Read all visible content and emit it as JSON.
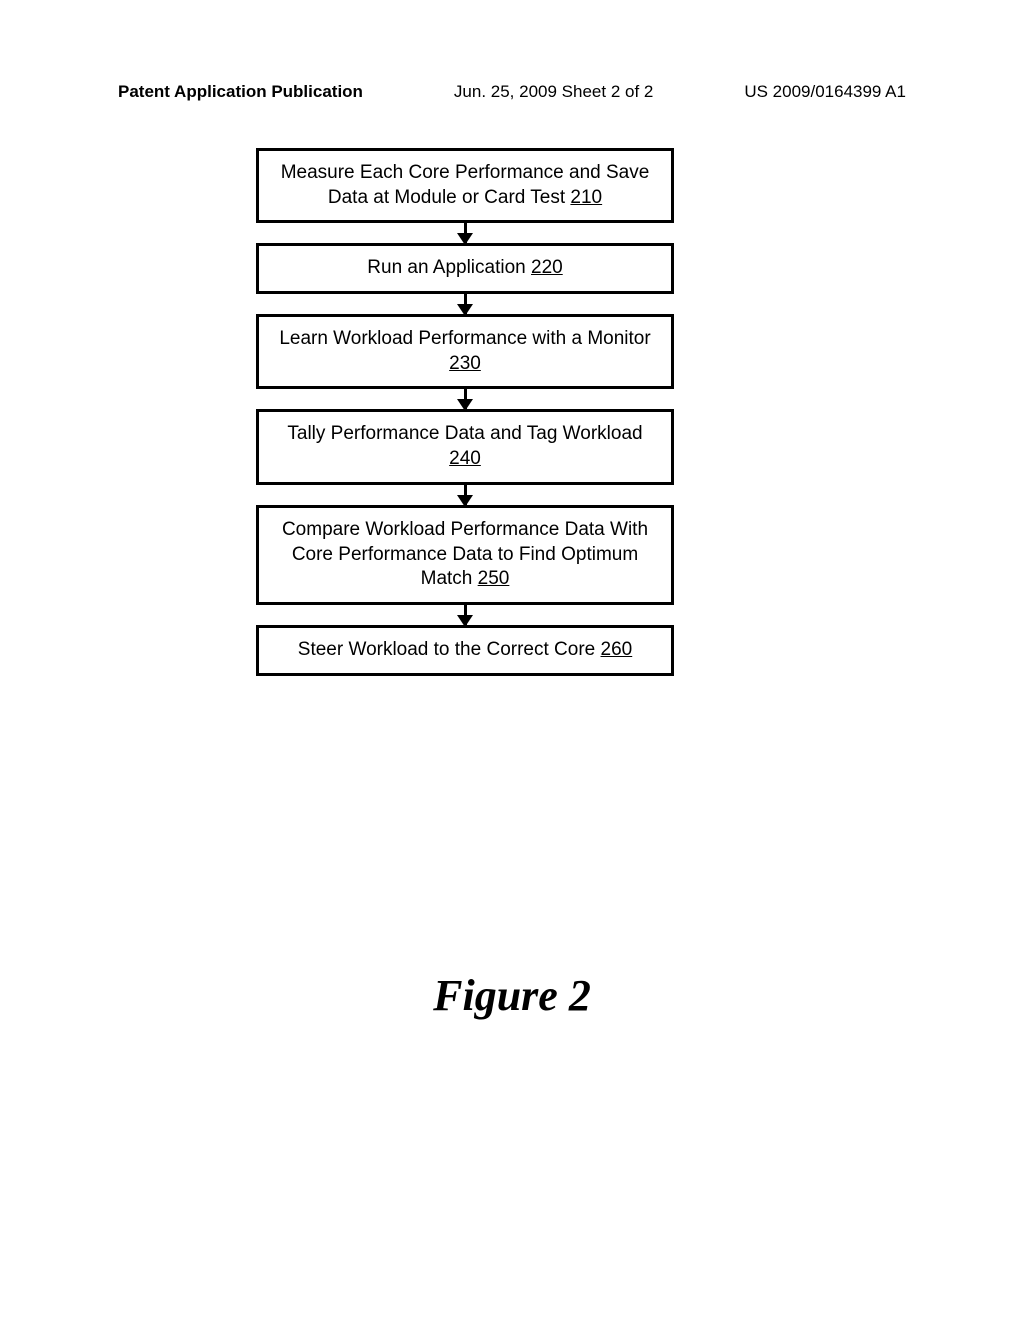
{
  "header": {
    "left": "Patent Application Publication",
    "mid": "Jun. 25, 2009  Sheet 2 of 2",
    "right": "US 2009/0164399 A1"
  },
  "flowchart": {
    "boxes": [
      {
        "text": "Measure Each Core Performance and Save Data at Module or Card Test",
        "ref": "210"
      },
      {
        "text": "Run an Application",
        "ref": "220"
      },
      {
        "text": "Learn Workload Performance with a Monitor",
        "ref": "230"
      },
      {
        "text": "Tally Performance Data and Tag Workload",
        "ref": "240"
      },
      {
        "text": "Compare Workload Performance Data With Core Performance Data to Find Optimum Match",
        "ref": "250"
      },
      {
        "text": "Steer Workload to the Correct Core",
        "ref": "260"
      }
    ]
  },
  "figure_label": "Figure 2",
  "chart_data": {
    "type": "flowchart",
    "title": "Figure 2",
    "direction": "top-to-bottom",
    "nodes": [
      {
        "id": "210",
        "label": "Measure Each Core Performance and Save Data at Module or Card Test"
      },
      {
        "id": "220",
        "label": "Run an Application"
      },
      {
        "id": "230",
        "label": "Learn Workload Performance with a Monitor"
      },
      {
        "id": "240",
        "label": "Tally Performance Data and Tag Workload"
      },
      {
        "id": "250",
        "label": "Compare Workload Performance Data With Core Performance Data to Find Optimum Match"
      },
      {
        "id": "260",
        "label": "Steer Workload to the Correct Core"
      }
    ],
    "edges": [
      {
        "from": "210",
        "to": "220"
      },
      {
        "from": "220",
        "to": "230"
      },
      {
        "from": "230",
        "to": "240"
      },
      {
        "from": "240",
        "to": "250"
      },
      {
        "from": "250",
        "to": "260"
      }
    ]
  }
}
